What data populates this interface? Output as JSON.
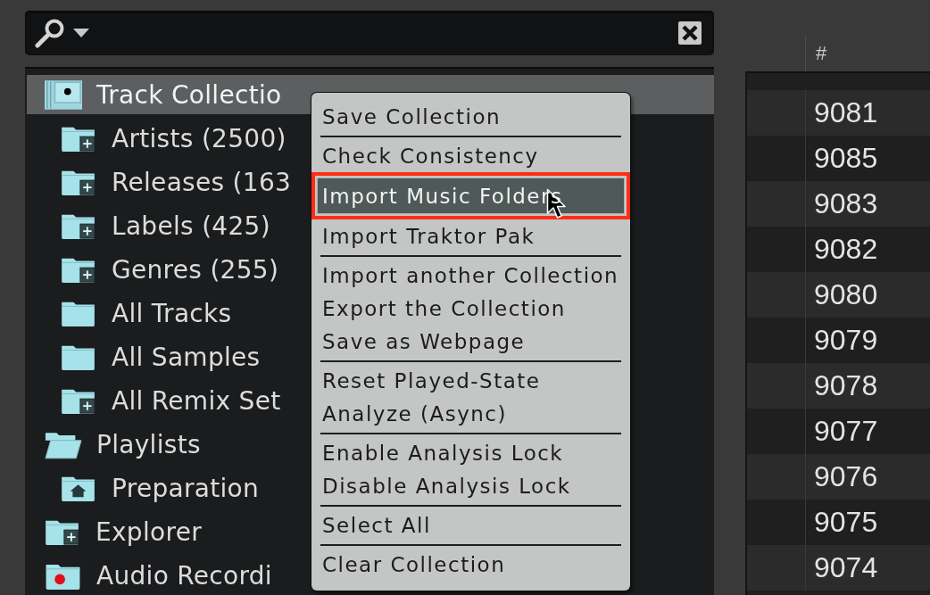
{
  "tree": {
    "items": [
      {
        "label": "Track Collectio",
        "kind": "collection",
        "selected": true,
        "children": [
          {
            "label": "Artists (2500)",
            "kind": "category",
            "selected": false
          },
          {
            "label": "Releases (163",
            "kind": "category",
            "selected": false
          },
          {
            "label": "Labels (425)",
            "kind": "category",
            "selected": false
          },
          {
            "label": "Genres (255)",
            "kind": "category",
            "selected": false
          },
          {
            "label": "All Tracks",
            "kind": "list",
            "selected": false
          },
          {
            "label": "All Samples",
            "kind": "list",
            "selected": false
          },
          {
            "label": "All Remix Set",
            "kind": "category",
            "selected": false
          }
        ]
      },
      {
        "label": "Playlists",
        "kind": "playlists",
        "selected": false,
        "children": [
          {
            "label": "Preparation",
            "kind": "playlist",
            "selected": false
          }
        ]
      },
      {
        "label": "Explorer",
        "kind": "explorer",
        "selected": false
      },
      {
        "label": "Audio Recordi",
        "kind": "recording",
        "selected": false
      }
    ]
  },
  "menu": {
    "groups": [
      {
        "items": [
          {
            "label": "Save Collection",
            "selected": false,
            "outlined": false
          }
        ]
      },
      {
        "items": [
          {
            "label": "Check Consistency",
            "selected": false,
            "outlined": false
          },
          {
            "label": "Import Music Folders",
            "selected": true,
            "outlined": true
          },
          {
            "label": "Import Traktor Pak",
            "selected": false,
            "outlined": false
          }
        ]
      },
      {
        "items": [
          {
            "label": "Import another Collection",
            "selected": false,
            "outlined": false
          },
          {
            "label": "Export the Collection",
            "selected": false,
            "outlined": false
          },
          {
            "label": "Save as Webpage",
            "selected": false,
            "outlined": false
          }
        ]
      },
      {
        "items": [
          {
            "label": "Reset Played-State",
            "selected": false,
            "outlined": false
          },
          {
            "label": "Analyze (Async)",
            "selected": false,
            "outlined": false
          }
        ]
      },
      {
        "items": [
          {
            "label": "Enable Analysis Lock",
            "selected": false,
            "outlined": false
          },
          {
            "label": "Disable Analysis Lock",
            "selected": false,
            "outlined": false
          }
        ]
      },
      {
        "items": [
          {
            "label": "Select All",
            "selected": false,
            "outlined": false
          }
        ]
      },
      {
        "items": [
          {
            "label": "Clear Collection",
            "selected": false,
            "outlined": false
          }
        ]
      }
    ]
  },
  "table": {
    "columns": [
      {
        "label": "#"
      }
    ],
    "rows": [
      {
        "cells": [
          "9081"
        ]
      },
      {
        "cells": [
          "9085"
        ]
      },
      {
        "cells": [
          "9083"
        ]
      },
      {
        "cells": [
          "9082"
        ]
      },
      {
        "cells": [
          "9080"
        ]
      },
      {
        "cells": [
          "9079"
        ]
      },
      {
        "cells": [
          "9078"
        ]
      },
      {
        "cells": [
          "9077"
        ]
      },
      {
        "cells": [
          "9076"
        ]
      },
      {
        "cells": [
          "9075"
        ]
      },
      {
        "cells": [
          "9074"
        ]
      }
    ]
  }
}
